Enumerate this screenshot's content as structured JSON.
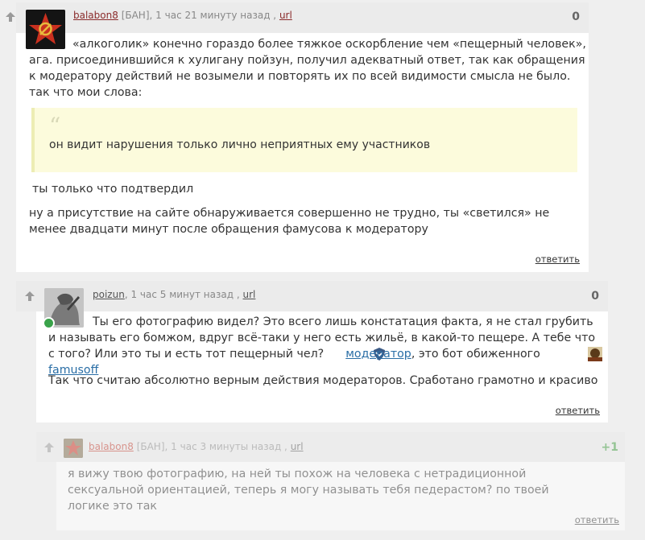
{
  "comments": [
    {
      "user": "balabon8",
      "status": "[БАН],",
      "time": "1 час 21 минуту назад ,",
      "url_label": "url",
      "score": "0",
      "paragraphs": [
        "«алкоголик» конечно гораздо более тяжкое оскорбление чем «пещерный человек», ага. присоединившийся к хулигану пойзун, получил адекватный ответ, так как обращения к модератору действий не возымели и повторять их по всей видимости смысла не было. так что мои слова:",
        "ты только что подтвердил",
        "ну а присутствие на сайте обнаруживается совершенно не трудно, ты «светился» не менее двадцати минут после обращения фамусова к модератору"
      ],
      "quote_mark": "“",
      "quote": "он видит нарушения только лично неприятных ему участников",
      "reply_label": "ответить"
    },
    {
      "user": "poizun",
      "time": ", 1 час 5 минут назад ,",
      "url_label": "url",
      "score": "0",
      "p1_before": "Ты его фотографию видел? Это всего лишь констатация факта, я не стал грубить и называть его бомжом, вдруг всё-таки у него есть жильё, в какой-то пещере. А тебе что с того? Или это ты и есть тот пещерный чел?",
      "mention1": "модератор",
      "p1_mid": ", это бот обиженного",
      "mention2": "famusoff",
      "p2": "Так что считаю абсолютно верным действия модераторов. Сработано грамотно и красиво",
      "reply_label": "ответить"
    },
    {
      "user": "balabon8",
      "status": "[БАН],",
      "time": "1 час 3 минуты назад ,",
      "url_label": "url",
      "score": "+1",
      "paragraph": "я вижу твою фотографию, на ней ты похож на человека с нетрадиционной сексуальной ориентацией, теперь я могу называть тебя педерастом? по твоей логике это так",
      "reply_label": "ответить"
    }
  ],
  "icons": {
    "vote": "upvote-arrow-icon",
    "online": "online-status-icon",
    "moderator": "moderator-shield-icon",
    "user_avatar": "user-avatar-icon"
  },
  "colors": {
    "username": "#8a2b2b",
    "mention": "#2a6ea6",
    "score_positive": "#7ab55c",
    "quote_bg": "#fcfbdc",
    "online": "#3aa34a"
  }
}
